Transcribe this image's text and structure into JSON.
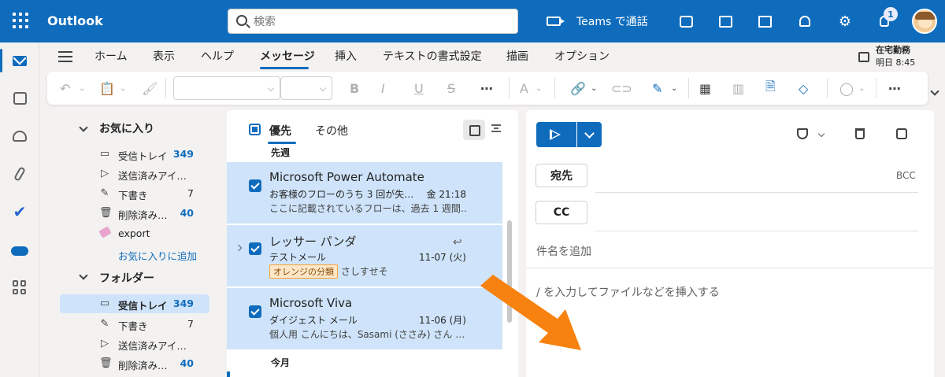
{
  "header": {
    "app_title": "Outlook",
    "search_placeholder": "検索",
    "teams_label": "Teams で通話",
    "tips_badge": "1",
    "brand_color": "#0f6cbd"
  },
  "rail": {
    "items": [
      "mail-icon",
      "calendar-icon",
      "people-icon",
      "attachment-icon",
      "todo-icon",
      "onedrive-icon",
      "apps-icon"
    ]
  },
  "ribbon": {
    "tabs": [
      "ホーム",
      "表示",
      "ヘルプ",
      "メッセージ",
      "挿入",
      "テキストの書式設定",
      "描画",
      "オプション"
    ],
    "active_tab": "メッセージ",
    "status_title": "在宅勤務",
    "status_time": "明日 8:45"
  },
  "folders": {
    "favorites_title": "お気に入り",
    "favorites": [
      {
        "label": "受信トレイ",
        "count": "349"
      },
      {
        "label": "送信済みアイ…",
        "count": ""
      },
      {
        "label": "下書き",
        "count": "7"
      },
      {
        "label": "削除済み…",
        "count": "40"
      },
      {
        "label": "export",
        "count": ""
      }
    ],
    "add_favorite": "お気に入りに追加",
    "folders_title": "フォルダー",
    "folder_items": [
      {
        "label": "受信トレイ",
        "count": "349"
      },
      {
        "label": "下書き",
        "count": "7"
      },
      {
        "label": "送信済みアイ…",
        "count": ""
      },
      {
        "label": "削除済み…",
        "count": "40"
      }
    ]
  },
  "message_list": {
    "tab_focused": "優先",
    "tab_other": "その他",
    "group_last_week": "先週",
    "group_this_month": "今月",
    "messages": [
      {
        "sender": "Microsoft Power Automate",
        "subject": "お客様のフローのうち 3 回が失…",
        "time": "金 21:18",
        "preview": "ここに記載されているフローは、過去 1 週間…"
      },
      {
        "sender": "レッサー パンダ",
        "subject": "テストメール",
        "time": "11-07 (火)",
        "category": "オレンジの分類",
        "preview": "さしすせそ"
      },
      {
        "sender": "Microsoft Viva",
        "subject": "ダイジェスト メール",
        "time": "11-06 (月)",
        "preview": "個人用 こんにちは、Sasami (ささみ) さん …"
      }
    ]
  },
  "compose": {
    "to_label": "宛先",
    "cc_label": "CC",
    "bcc_label": "BCC",
    "subject_placeholder": "件名を追加",
    "body_placeholder": "/ を入力してファイルなどを挿入する"
  },
  "annotation": {
    "arrow_color": "#f7820f"
  }
}
